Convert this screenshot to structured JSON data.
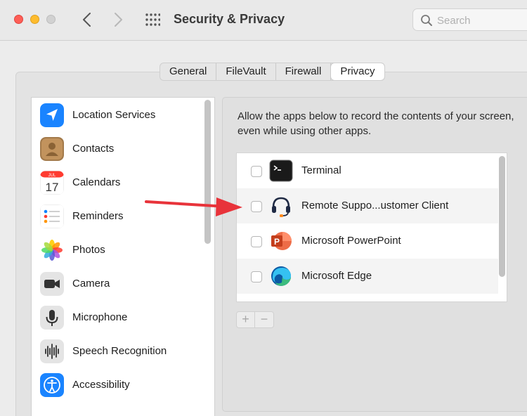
{
  "window": {
    "title": "Security & Privacy"
  },
  "search": {
    "placeholder": "Search"
  },
  "tabs": [
    {
      "label": "General",
      "active": false
    },
    {
      "label": "FileVault",
      "active": false
    },
    {
      "label": "Firewall",
      "active": false
    },
    {
      "label": "Privacy",
      "active": true
    }
  ],
  "sidebar": {
    "items": [
      {
        "label": "Location Services",
        "icon": "location-arrow-icon"
      },
      {
        "label": "Contacts",
        "icon": "contacts-icon"
      },
      {
        "label": "Calendars",
        "icon": "calendar-icon",
        "icon_month": "JUL",
        "icon_day": "17"
      },
      {
        "label": "Reminders",
        "icon": "reminders-icon"
      },
      {
        "label": "Photos",
        "icon": "photos-icon"
      },
      {
        "label": "Camera",
        "icon": "camera-icon"
      },
      {
        "label": "Microphone",
        "icon": "microphone-icon"
      },
      {
        "label": "Speech Recognition",
        "icon": "waveform-icon"
      },
      {
        "label": "Accessibility",
        "icon": "accessibility-icon"
      }
    ]
  },
  "main": {
    "description": "Allow the apps below to record the contents of your screen, even while using other apps.",
    "apps": [
      {
        "name": "Terminal",
        "checked": false,
        "icon": "terminal-icon"
      },
      {
        "name": "Remote Suppo...ustomer Client",
        "checked": false,
        "icon": "headset-icon"
      },
      {
        "name": "Microsoft PowerPoint",
        "checked": false,
        "icon": "powerpoint-icon"
      },
      {
        "name": "Microsoft Edge",
        "checked": false,
        "icon": "edge-icon"
      }
    ],
    "add_label": "+",
    "remove_label": "−"
  },
  "colors": {
    "accent_red_arrow": "#e8333a",
    "window_bg": "#ececec",
    "list_bg": "#ffffff"
  }
}
